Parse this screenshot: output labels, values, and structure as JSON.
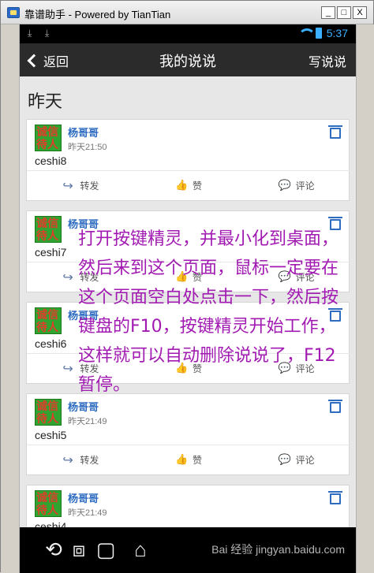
{
  "window": {
    "title": "靠谱助手 - Powered by TianTian",
    "buttons": [
      "_",
      "□",
      "X"
    ]
  },
  "status_bar": {
    "time": "5:37"
  },
  "app_bar": {
    "back_label": "返回",
    "title": "我的说说",
    "right_action": "写说说"
  },
  "section_title": "昨天",
  "actions": {
    "share": "转发",
    "like": "赞",
    "comment": "评论"
  },
  "posts": [
    {
      "author": "杨哥哥",
      "time": "昨天21:50",
      "text": "ceshi8"
    },
    {
      "author": "杨哥哥",
      "time": "",
      "text": "ceshi7"
    },
    {
      "author": "杨哥哥",
      "time": "",
      "text": "ceshi6"
    },
    {
      "author": "杨哥哥",
      "time": "昨天21:49",
      "text": "ceshi5"
    },
    {
      "author": "杨哥哥",
      "time": "昨天21:49",
      "text": "ceshi4"
    }
  ],
  "overlay_text": "打开按键精灵，并最小化到桌面，然后来到这个页面，鼠标一定要在这个页面空白处点击一下，然后按键盘的F10，按键精灵开始工作，这样就可以自动删除说说了，F12暂停。",
  "nav": {
    "watermark": "Bai 经验 jingyan.baidu.com"
  },
  "icons": [
    "app-icon",
    "download-icon",
    "wifi-icon",
    "battery-icon",
    "back-chevron-icon",
    "trash-icon",
    "share-icon",
    "like-icon",
    "comment-icon",
    "nav-back-icon",
    "rotate-icon",
    "screenshot-icon",
    "home-icon"
  ],
  "colors": {
    "accent": "#2d6cc0",
    "overlay": "#a11ab1",
    "appbar": "#2b2b2b"
  }
}
